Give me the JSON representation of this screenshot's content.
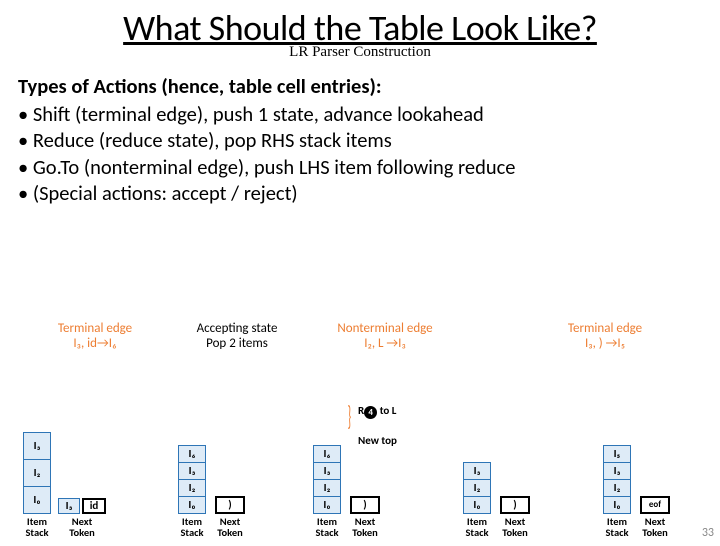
{
  "title": "What Should the Table Look Like?",
  "subtitle": "LR Parser Construction",
  "lead": "Types of Actions (hence, table cell entries):",
  "bullets": [
    "Shift (terminal edge), push 1 state, advance lookahead",
    "Reduce (reduce state), pop RHS stack items",
    "Go.To (nonterminal edge), push LHS item following reduce",
    "(Special actions: accept / reject)"
  ],
  "labels": {
    "c1a": "Terminal edge",
    "c1b": "I₃, id→I₆",
    "c2a": "Accepting state",
    "c2b": "Pop 2 items",
    "c3a": "Nonterminal edge",
    "c3b": "I₂, L →I₃",
    "c4a": "Terminal edge",
    "c4b": "I₃, ) →I₅"
  },
  "stacks": {
    "s1": [
      "I₀",
      "I₂",
      "I₃"
    ],
    "s1b_left": "I₃",
    "s1b_token": "id",
    "s2": [
      "I₀",
      "I₂",
      "I₃",
      "I₆"
    ],
    "s2_token": ")",
    "s3": [
      "I₀",
      "I₂",
      "I₃",
      "I₆"
    ],
    "s3_token": ")",
    "s4": [
      "I₀",
      "I₂",
      "I₃"
    ],
    "s4_token": ")",
    "s5": [
      "I₀",
      "I₂",
      "I₃",
      "I₅"
    ],
    "s5_token": "eof"
  },
  "annot": {
    "r4": "R",
    "r4_num": "4",
    "r4_tail": " to L",
    "newtop": "New top"
  },
  "stack_lbl": "Item\nStack",
  "next_lbl": "Next\nToken",
  "page": "33"
}
